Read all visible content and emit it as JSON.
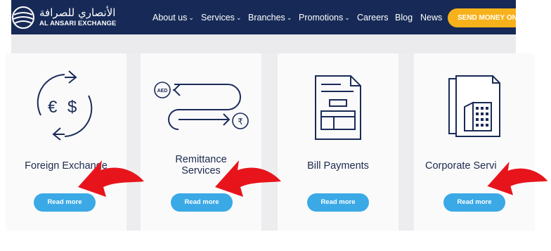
{
  "header": {
    "logo": {
      "arabic": "الأنصاري للصرافة",
      "english": "AL ANSARI EXCHANGE"
    },
    "nav": [
      {
        "label": "About us",
        "dropdown": true
      },
      {
        "label": "Services",
        "dropdown": true
      },
      {
        "label": "Branches",
        "dropdown": true
      },
      {
        "label": "Promotions",
        "dropdown": true
      },
      {
        "label": "Careers",
        "dropdown": false
      },
      {
        "label": "Blog",
        "dropdown": false
      },
      {
        "label": "News",
        "dropdown": false
      }
    ],
    "cta": "SEND MONEY ONL"
  },
  "cards": [
    {
      "title": "Foreign Exchange",
      "button": "Read more",
      "icon": "currency-exchange-icon",
      "symbols": [
        "€",
        "$"
      ]
    },
    {
      "title_lines": [
        "Remittance",
        "Services"
      ],
      "button": "Read more",
      "icon": "remittance-icon",
      "currency": "AED",
      "target_currency": "₹"
    },
    {
      "title": "Bill Payments",
      "button": "Read more",
      "icon": "bill-document-icon"
    },
    {
      "title": "Corporate Servi",
      "button": "Read more",
      "icon": "corporate-building-icon"
    }
  ],
  "colors": {
    "header_bg": "#172a57",
    "cta_bg": "#f7b21b",
    "button_bg": "#3aa9e6",
    "annotation_arrow": "#e8141c",
    "icon_stroke": "#1a2b58"
  }
}
